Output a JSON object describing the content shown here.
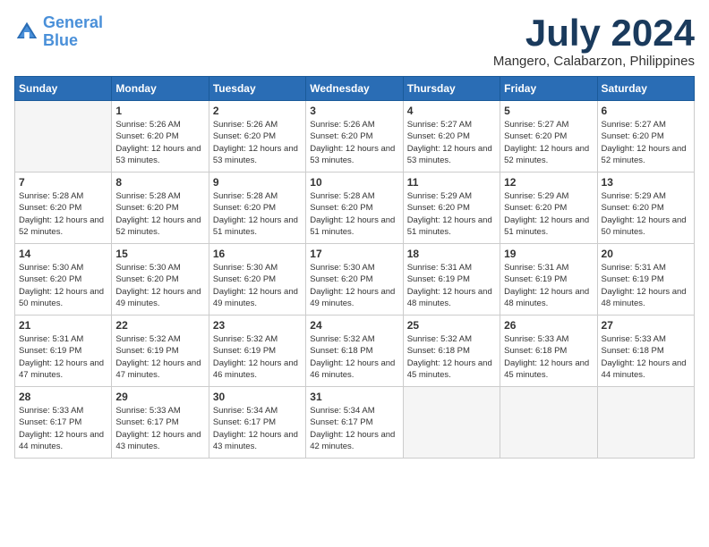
{
  "header": {
    "logo_line1": "General",
    "logo_line2": "Blue",
    "month_title": "July 2024",
    "location": "Mangero, Calabarzon, Philippines"
  },
  "days_of_week": [
    "Sunday",
    "Monday",
    "Tuesday",
    "Wednesday",
    "Thursday",
    "Friday",
    "Saturday"
  ],
  "weeks": [
    [
      {
        "day": "",
        "empty": true
      },
      {
        "day": "1",
        "sunrise": "5:26 AM",
        "sunset": "6:20 PM",
        "daylight": "12 hours and 53 minutes."
      },
      {
        "day": "2",
        "sunrise": "5:26 AM",
        "sunset": "6:20 PM",
        "daylight": "12 hours and 53 minutes."
      },
      {
        "day": "3",
        "sunrise": "5:26 AM",
        "sunset": "6:20 PM",
        "daylight": "12 hours and 53 minutes."
      },
      {
        "day": "4",
        "sunrise": "5:27 AM",
        "sunset": "6:20 PM",
        "daylight": "12 hours and 53 minutes."
      },
      {
        "day": "5",
        "sunrise": "5:27 AM",
        "sunset": "6:20 PM",
        "daylight": "12 hours and 52 minutes."
      },
      {
        "day": "6",
        "sunrise": "5:27 AM",
        "sunset": "6:20 PM",
        "daylight": "12 hours and 52 minutes."
      }
    ],
    [
      {
        "day": "7",
        "sunrise": "5:28 AM",
        "sunset": "6:20 PM",
        "daylight": "12 hours and 52 minutes."
      },
      {
        "day": "8",
        "sunrise": "5:28 AM",
        "sunset": "6:20 PM",
        "daylight": "12 hours and 52 minutes."
      },
      {
        "day": "9",
        "sunrise": "5:28 AM",
        "sunset": "6:20 PM",
        "daylight": "12 hours and 51 minutes."
      },
      {
        "day": "10",
        "sunrise": "5:28 AM",
        "sunset": "6:20 PM",
        "daylight": "12 hours and 51 minutes."
      },
      {
        "day": "11",
        "sunrise": "5:29 AM",
        "sunset": "6:20 PM",
        "daylight": "12 hours and 51 minutes."
      },
      {
        "day": "12",
        "sunrise": "5:29 AM",
        "sunset": "6:20 PM",
        "daylight": "12 hours and 51 minutes."
      },
      {
        "day": "13",
        "sunrise": "5:29 AM",
        "sunset": "6:20 PM",
        "daylight": "12 hours and 50 minutes."
      }
    ],
    [
      {
        "day": "14",
        "sunrise": "5:30 AM",
        "sunset": "6:20 PM",
        "daylight": "12 hours and 50 minutes."
      },
      {
        "day": "15",
        "sunrise": "5:30 AM",
        "sunset": "6:20 PM",
        "daylight": "12 hours and 49 minutes."
      },
      {
        "day": "16",
        "sunrise": "5:30 AM",
        "sunset": "6:20 PM",
        "daylight": "12 hours and 49 minutes."
      },
      {
        "day": "17",
        "sunrise": "5:30 AM",
        "sunset": "6:20 PM",
        "daylight": "12 hours and 49 minutes."
      },
      {
        "day": "18",
        "sunrise": "5:31 AM",
        "sunset": "6:19 PM",
        "daylight": "12 hours and 48 minutes."
      },
      {
        "day": "19",
        "sunrise": "5:31 AM",
        "sunset": "6:19 PM",
        "daylight": "12 hours and 48 minutes."
      },
      {
        "day": "20",
        "sunrise": "5:31 AM",
        "sunset": "6:19 PM",
        "daylight": "12 hours and 48 minutes."
      }
    ],
    [
      {
        "day": "21",
        "sunrise": "5:31 AM",
        "sunset": "6:19 PM",
        "daylight": "12 hours and 47 minutes."
      },
      {
        "day": "22",
        "sunrise": "5:32 AM",
        "sunset": "6:19 PM",
        "daylight": "12 hours and 47 minutes."
      },
      {
        "day": "23",
        "sunrise": "5:32 AM",
        "sunset": "6:19 PM",
        "daylight": "12 hours and 46 minutes."
      },
      {
        "day": "24",
        "sunrise": "5:32 AM",
        "sunset": "6:18 PM",
        "daylight": "12 hours and 46 minutes."
      },
      {
        "day": "25",
        "sunrise": "5:32 AM",
        "sunset": "6:18 PM",
        "daylight": "12 hours and 45 minutes."
      },
      {
        "day": "26",
        "sunrise": "5:33 AM",
        "sunset": "6:18 PM",
        "daylight": "12 hours and 45 minutes."
      },
      {
        "day": "27",
        "sunrise": "5:33 AM",
        "sunset": "6:18 PM",
        "daylight": "12 hours and 44 minutes."
      }
    ],
    [
      {
        "day": "28",
        "sunrise": "5:33 AM",
        "sunset": "6:17 PM",
        "daylight": "12 hours and 44 minutes."
      },
      {
        "day": "29",
        "sunrise": "5:33 AM",
        "sunset": "6:17 PM",
        "daylight": "12 hours and 43 minutes."
      },
      {
        "day": "30",
        "sunrise": "5:34 AM",
        "sunset": "6:17 PM",
        "daylight": "12 hours and 43 minutes."
      },
      {
        "day": "31",
        "sunrise": "5:34 AM",
        "sunset": "6:17 PM",
        "daylight": "12 hours and 42 minutes."
      },
      {
        "day": "",
        "empty": true
      },
      {
        "day": "",
        "empty": true
      },
      {
        "day": "",
        "empty": true
      }
    ]
  ]
}
